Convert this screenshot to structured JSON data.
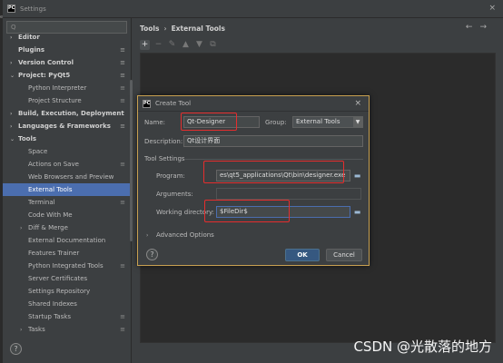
{
  "window": {
    "title": "Settings",
    "close_glyph": "×",
    "side_letters": "ec"
  },
  "sidebar": {
    "search_placeholder": "Q",
    "items": [
      {
        "label": "Editor",
        "bold": true,
        "arrow": "›"
      },
      {
        "label": "Plugins",
        "bold": true,
        "cfg": true
      },
      {
        "label": "Version Control",
        "bold": true,
        "arrow": "›",
        "cfg": true
      },
      {
        "label": "Project: PyQt5",
        "bold": true,
        "arrow": "⌄",
        "cfg": true
      },
      {
        "label": "Python Interpreter",
        "cfg": true
      },
      {
        "label": "Project Structure",
        "cfg": true
      },
      {
        "label": "Build, Execution, Deployment",
        "bold": true,
        "arrow": "›"
      },
      {
        "label": "Languages & Frameworks",
        "bold": true,
        "arrow": "›",
        "cfg": true
      },
      {
        "label": "Tools",
        "bold": true,
        "arrow": "⌄"
      },
      {
        "label": "Space"
      },
      {
        "label": "Actions on Save",
        "cfg": true
      },
      {
        "label": "Web Browsers and Preview"
      },
      {
        "label": "External Tools",
        "selected": true
      },
      {
        "label": "Terminal",
        "cfg": true
      },
      {
        "label": "Code With Me"
      },
      {
        "label": "Diff & Merge",
        "arrow": "›"
      },
      {
        "label": "External Documentation"
      },
      {
        "label": "Features Trainer"
      },
      {
        "label": "Python Integrated Tools",
        "cfg": true
      },
      {
        "label": "Server Certificates"
      },
      {
        "label": "Settings Repository"
      },
      {
        "label": "Shared Indexes"
      },
      {
        "label": "Startup Tasks",
        "cfg": true
      },
      {
        "label": "Tasks",
        "arrow": "›",
        "cfg": true
      }
    ],
    "help": "?"
  },
  "breadcrumb": {
    "parent": "Tools",
    "separator": "›",
    "current": "External Tools"
  },
  "nav": {
    "back": "←",
    "forward": "→"
  },
  "toolbar": {
    "add": "+",
    "remove": "−",
    "edit": "✎",
    "up": "▲",
    "down": "▼",
    "copy": "⧉"
  },
  "dialog": {
    "title": "Create Tool",
    "close": "×",
    "name_label": "Name:",
    "name_value": "Qt-Designer",
    "group_label": "Group:",
    "group_value": "External Tools",
    "description_label": "Description:",
    "description_value": "Qt设计界面",
    "tool_settings_label": "Tool Settings",
    "program_label": "Program:",
    "program_value": "es\\qt5_applications\\Qt\\bin\\designer.exe",
    "arguments_label": "Arguments:",
    "arguments_value": "",
    "working_dir_label": "Working directory:",
    "working_dir_value": "$FileDir$",
    "advanced_label": "Advanced Options",
    "ok_label": "OK",
    "cancel_label": "Cancel",
    "help": "?"
  },
  "watermark": "CSDN @光散落的地方",
  "colors": {
    "selection": "#4b6eaf",
    "annotation": "#e52d2d",
    "primary_button": "#365880"
  }
}
